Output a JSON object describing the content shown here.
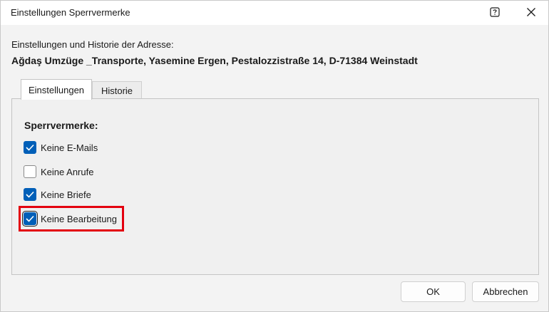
{
  "window": {
    "title": "Einstellungen Sperrvermerke",
    "help_icon": "help-question-icon",
    "close_icon": "close-icon"
  },
  "header": {
    "subtitle": "Einstellungen und Historie der Adresse:",
    "address": "Ağdaş Umzüge _Transporte, Yasemine Ergen, Pestalozzistraße 14, D-71384 Weinstadt"
  },
  "tabs": [
    {
      "label": "Einstellungen",
      "active": true
    },
    {
      "label": "Historie",
      "active": false
    }
  ],
  "settings": {
    "heading": "Sperrvermerke:",
    "options": [
      {
        "label": "Keine E-Mails",
        "checked": true
      },
      {
        "label": "Keine Anrufe",
        "checked": false
      },
      {
        "label": "Keine Briefe",
        "checked": true
      },
      {
        "label": "Keine Bearbeitung",
        "checked": true,
        "highlighted": true
      }
    ]
  },
  "buttons": {
    "ok_label": "OK",
    "cancel_label": "Abbrechen"
  },
  "colors": {
    "checkbox_checked": "#005fb8",
    "highlight_border": "#e3000f"
  }
}
